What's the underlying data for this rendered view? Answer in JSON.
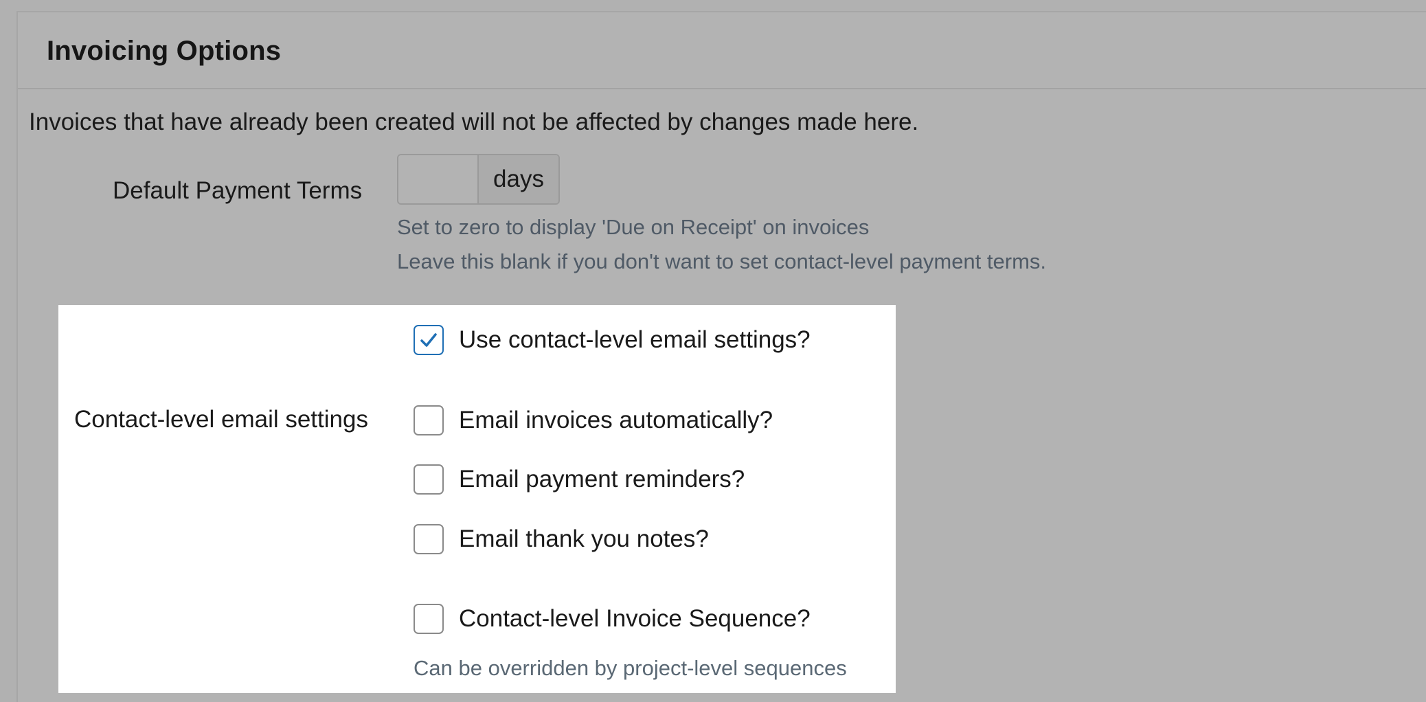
{
  "panel": {
    "title": "Invoicing Options",
    "intro": "Invoices that have already been created will not be affected by changes made here."
  },
  "payment_terms": {
    "label": "Default Payment Terms",
    "value": "",
    "unit": "days",
    "help_zero": "Set to zero to display 'Due on Receipt' on invoices",
    "help_blank": "Leave this blank if you don't want to set contact-level payment terms."
  },
  "email_settings": {
    "label": "Contact-level email settings",
    "options": [
      {
        "label": "Use contact-level email settings?",
        "checked": true
      },
      {
        "label": "Email invoices automatically?",
        "checked": false
      },
      {
        "label": "Email payment reminders?",
        "checked": false
      },
      {
        "label": "Email thank you notes?",
        "checked": false
      }
    ]
  },
  "invoice_sequence": {
    "label": "Contact-level Invoice Sequence?",
    "checked": false,
    "help": "Can be overridden by project-level sequences"
  },
  "colors": {
    "check_accent": "#1f6fb5",
    "help_text": "#4f5a66"
  }
}
